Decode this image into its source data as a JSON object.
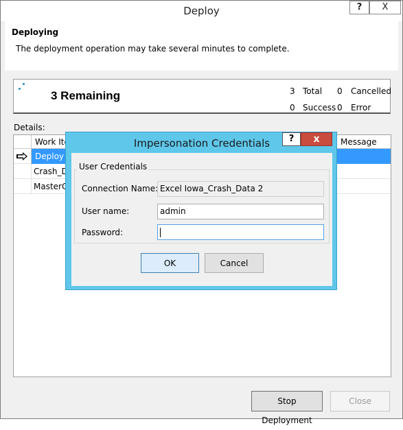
{
  "window": {
    "title": "Deploy",
    "help_label": "?",
    "close_label": "X"
  },
  "header": {
    "title": "Deploying",
    "description": "The deployment operation may take several minutes to complete."
  },
  "status": {
    "remaining": "3 Remaining",
    "total_count": "3",
    "total_label": "Total",
    "cancelled_count": "0",
    "cancelled_label": "Cancelled",
    "success_count": "0",
    "success_label": "Success",
    "error_count": "0",
    "error_label": "Error"
  },
  "details": {
    "label": "Details:",
    "columns": {
      "work_item": "Work Ite",
      "message": "Message"
    },
    "rows": [
      {
        "work_item": "Deploy n",
        "selected": true
      },
      {
        "work_item": "Crash_Da",
        "selected": false
      },
      {
        "work_item": "MasterCa",
        "selected": false
      }
    ]
  },
  "buttons": {
    "stop": "Stop Deployment",
    "close": "Close"
  },
  "dialog": {
    "title": "Impersonation Credentials",
    "help_label": "?",
    "close_label": "x",
    "group_label": "User Credentials",
    "connection_label": "Connection Name:",
    "connection_value": "Excel Iowa_Crash_Data 2",
    "username_label": "User name:",
    "username_value": "admin",
    "password_label": "Password:",
    "password_value": "",
    "ok_label": "OK",
    "cancel_label": "Cancel"
  },
  "colors": {
    "dialog_frame": "#5ec7ea",
    "selected_row": "#3399ff",
    "close_red": "#c94c3f"
  }
}
